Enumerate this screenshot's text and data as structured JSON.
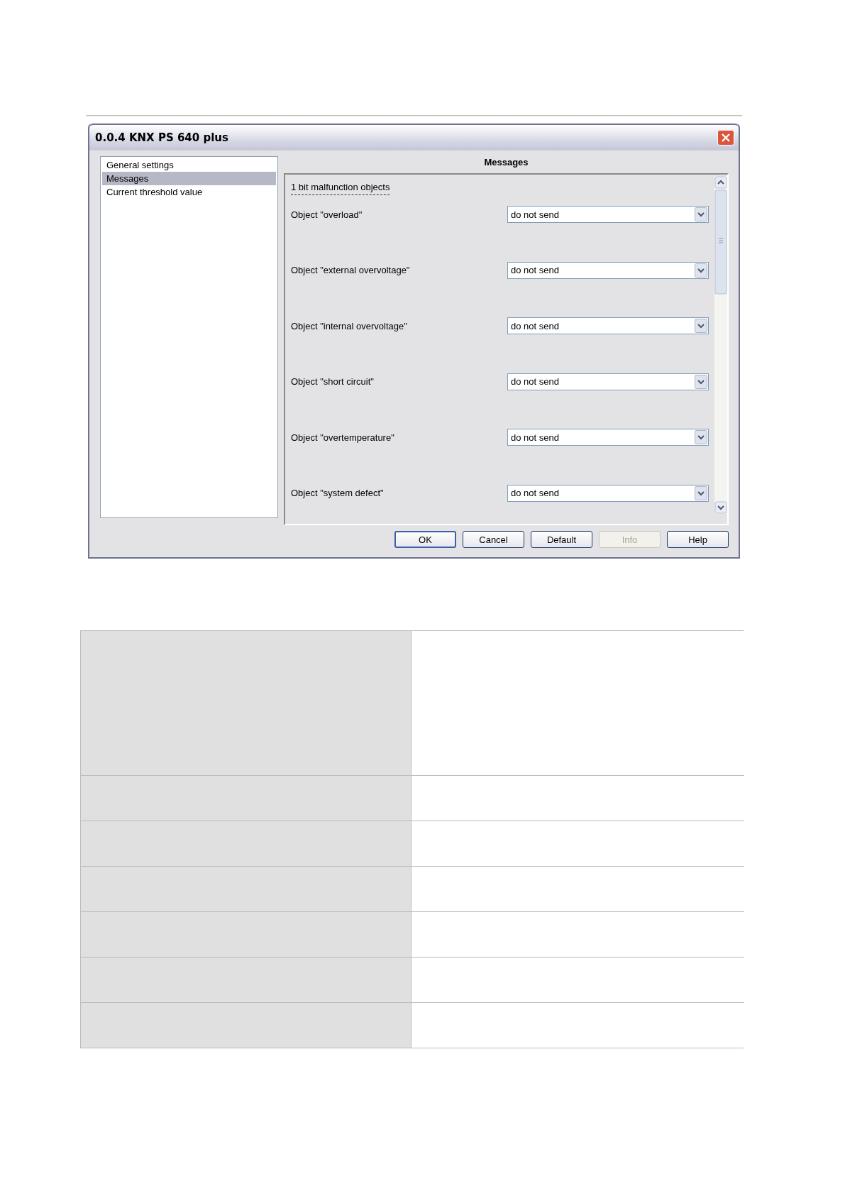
{
  "window": {
    "title": "0.0.4 KNX PS 640 plus"
  },
  "sidebar": {
    "items": [
      {
        "label": "General settings",
        "selected": false
      },
      {
        "label": "Messages",
        "selected": true
      },
      {
        "label": "Current threshold value",
        "selected": false
      }
    ]
  },
  "panel": {
    "title": "Messages",
    "section": "1 bit malfunction objects",
    "parameters": [
      {
        "label": "Object \"overload\"",
        "value": "do not send"
      },
      {
        "label": "Object \"external overvoltage\"",
        "value": "do not send"
      },
      {
        "label": "Object \"internal overvoltage\"",
        "value": "do not send"
      },
      {
        "label": "Object \"short circuit\"",
        "value": "do not send"
      },
      {
        "label": "Object \"overtemperature\"",
        "value": "do not send"
      },
      {
        "label": "Object \"system defect\"",
        "value": "do not send"
      }
    ]
  },
  "buttons": [
    {
      "label": "OK",
      "default": true,
      "disabled": false
    },
    {
      "label": "Cancel",
      "default": false,
      "disabled": false
    },
    {
      "label": "Default",
      "default": false,
      "disabled": false
    },
    {
      "label": "Info",
      "default": false,
      "disabled": true
    },
    {
      "label": "Help",
      "default": false,
      "disabled": false
    }
  ]
}
